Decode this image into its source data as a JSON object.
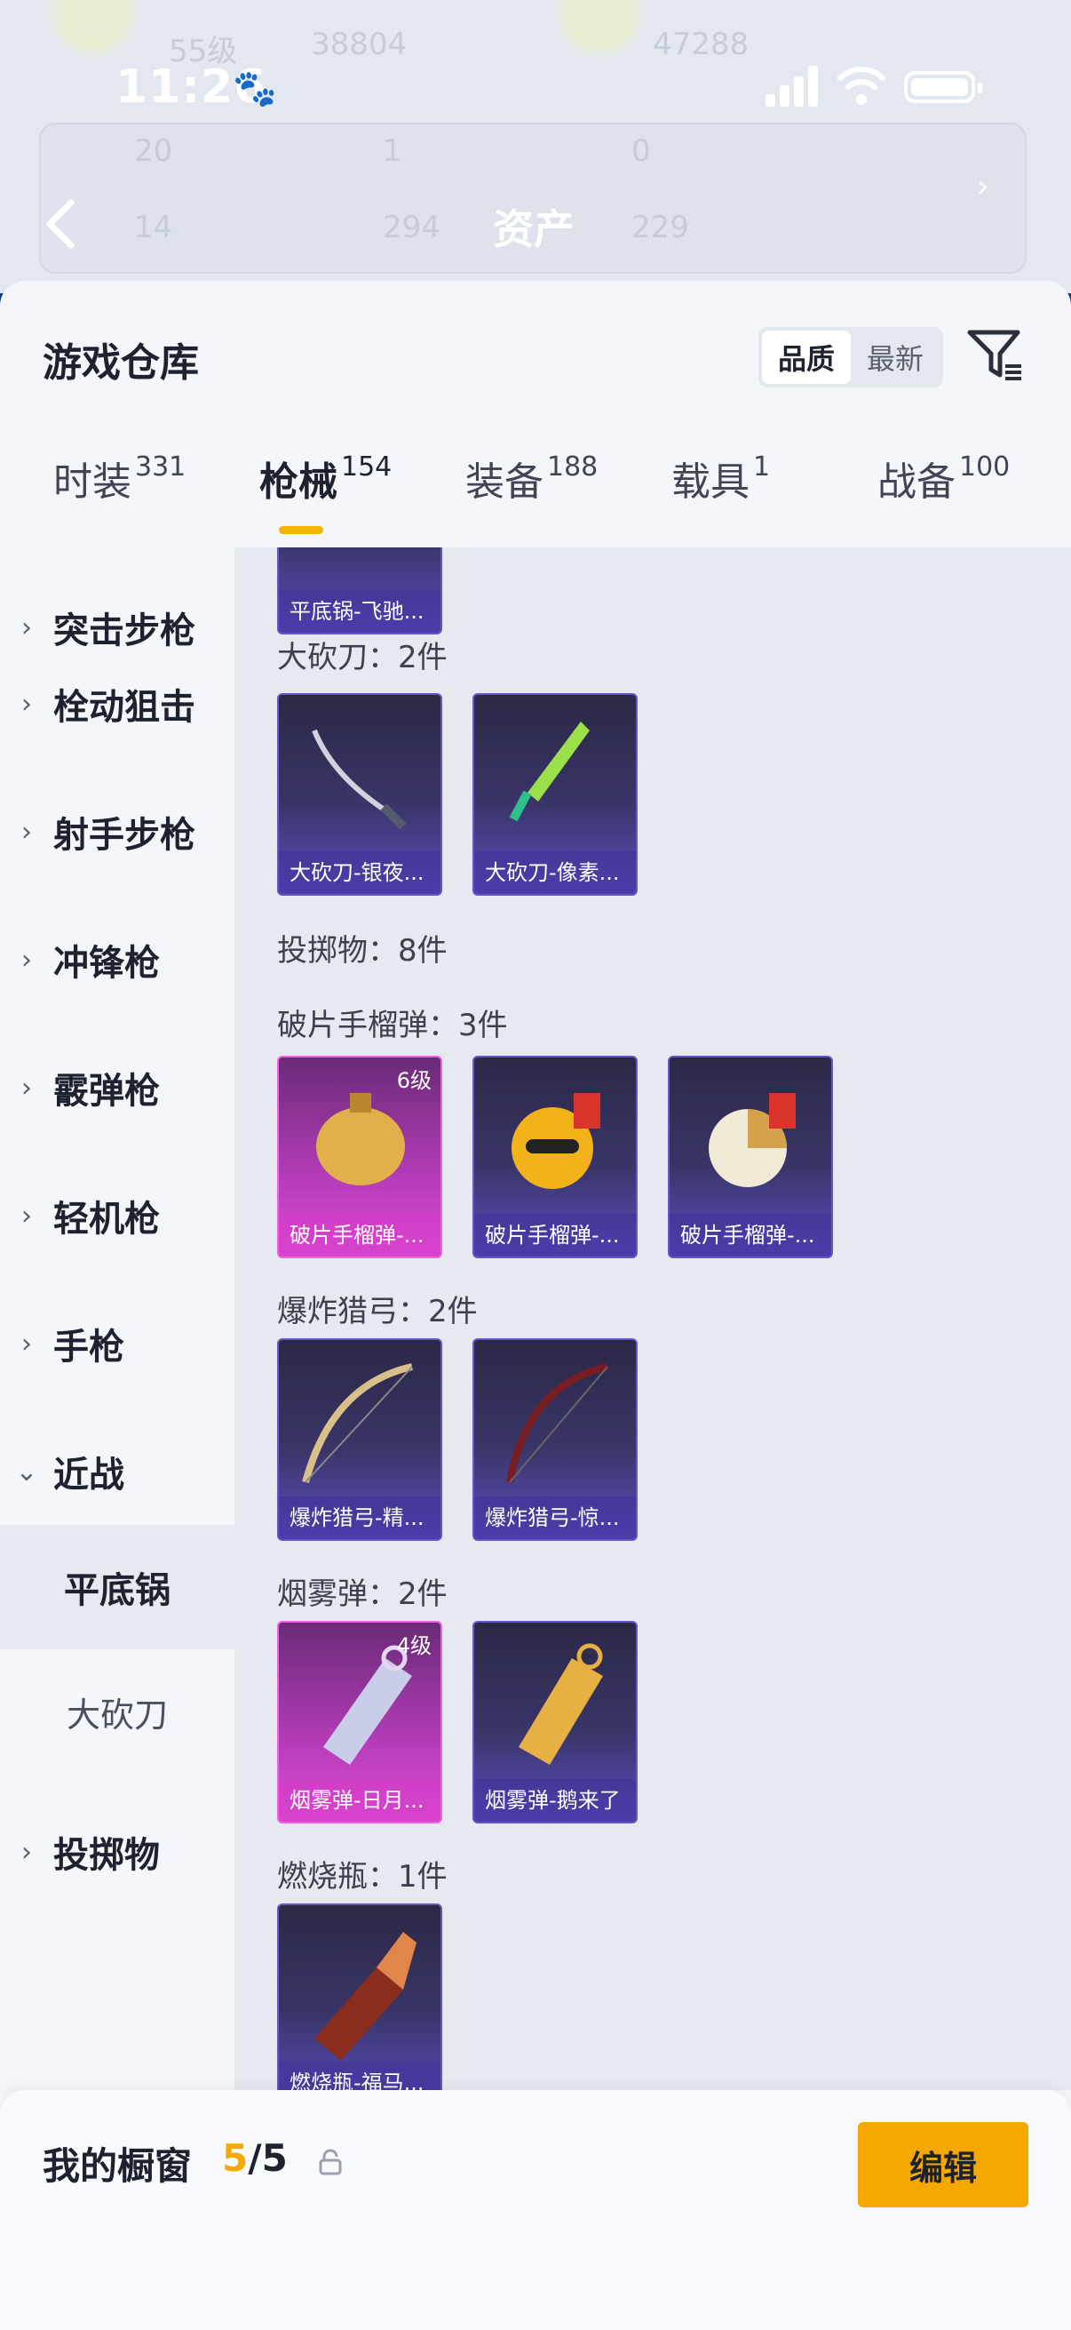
{
  "status_bar": {
    "time": "11:26"
  },
  "background_header": {
    "faint_texts": [
      "55级",
      "38804",
      "47288",
      "20",
      "1",
      "0",
      "14",
      "294",
      "229"
    ],
    "title": "资产"
  },
  "sheet": {
    "title": "游戏仓库",
    "sort_options": [
      "品质",
      "最新"
    ],
    "tabs": [
      {
        "label": "时装",
        "count": "331"
      },
      {
        "label": "枪械",
        "count": "154"
      },
      {
        "label": "装备",
        "count": "188"
      },
      {
        "label": "载具",
        "count": "1"
      },
      {
        "label": "战备",
        "count": "100"
      }
    ]
  },
  "sidebar": {
    "categories": [
      "突击步枪",
      "栓动狙击",
      "射手步枪",
      "冲锋枪",
      "霰弹枪",
      "轻机枪",
      "手枪",
      "近战",
      "投掷物"
    ],
    "sub_items": [
      "平底锅",
      "大砍刀"
    ]
  },
  "content": {
    "top_partial_card": "平底锅-飞驰...",
    "sections": [
      {
        "heading": "大砍刀：2件",
        "cards": [
          {
            "label": "大砍刀-银夜...",
            "level": "",
            "rarity": "purple"
          },
          {
            "label": "大砍刀-像素...",
            "level": "",
            "rarity": "purple"
          }
        ]
      },
      {
        "heading": "投掷物：8件",
        "cards": []
      },
      {
        "heading": "破片手榴弹：3件",
        "cards": [
          {
            "label": "破片手榴弹-...",
            "level": "6级",
            "rarity": "pink"
          },
          {
            "label": "破片手榴弹-...",
            "level": "",
            "rarity": "purple"
          },
          {
            "label": "破片手榴弹-...",
            "level": "",
            "rarity": "purple"
          }
        ]
      },
      {
        "heading": "爆炸猎弓：2件",
        "cards": [
          {
            "label": "爆炸猎弓-精...",
            "level": "",
            "rarity": "purple"
          },
          {
            "label": "爆炸猎弓-惊...",
            "level": "",
            "rarity": "purple"
          }
        ]
      },
      {
        "heading": "烟雾弹：2件",
        "cards": [
          {
            "label": "烟雾弹-日月...",
            "level": "4级",
            "rarity": "pink"
          },
          {
            "label": "烟雾弹-鹅来了",
            "level": "",
            "rarity": "purple"
          }
        ]
      },
      {
        "heading": "燃烧瓶：1件",
        "cards": [
          {
            "label": "燃烧瓶-福马...",
            "level": "",
            "rarity": "purple"
          }
        ]
      }
    ]
  },
  "bottom_bar": {
    "showcase_label": "我的橱窗",
    "showcase_used": "5",
    "showcase_total": "/5",
    "edit_label": "编辑"
  },
  "colors": {
    "accent": "#f5a800",
    "pink_rarity": "#e24fd6",
    "purple_rarity": "#5a4ec4"
  }
}
